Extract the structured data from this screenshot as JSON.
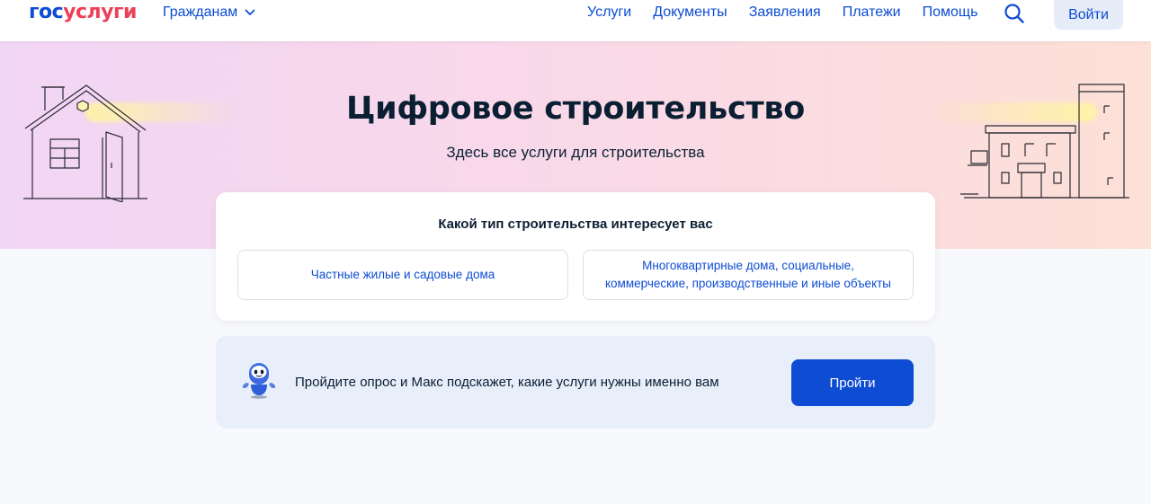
{
  "header": {
    "logo_part1": "гос",
    "logo_part2": "услуги",
    "audience_label": "Гражданам",
    "nav": [
      "Услуги",
      "Документы",
      "Заявления",
      "Платежи",
      "Помощь"
    ],
    "search_icon": "search-icon",
    "login_label": "Войти"
  },
  "hero": {
    "title": "Цифровое строительство",
    "subtitle": "Здесь все услуги для строительства"
  },
  "choice": {
    "title": "Какой тип строительства интересует вас",
    "option_private": "Частные жилые и садовые дома",
    "option_multi": "Многоквартирные дома, социальные,\nкоммерческие, производственные и иные объекты"
  },
  "quiz": {
    "text": "Пройдите опрос и Макс подскажет, какие услуги нужны именно вам",
    "button_label": "Пройти"
  },
  "colors": {
    "brand_blue": "#0d4cd3",
    "brand_red": "#ee3f58",
    "text_dark": "#0b1f33",
    "page_bg": "#f8f9fc"
  }
}
